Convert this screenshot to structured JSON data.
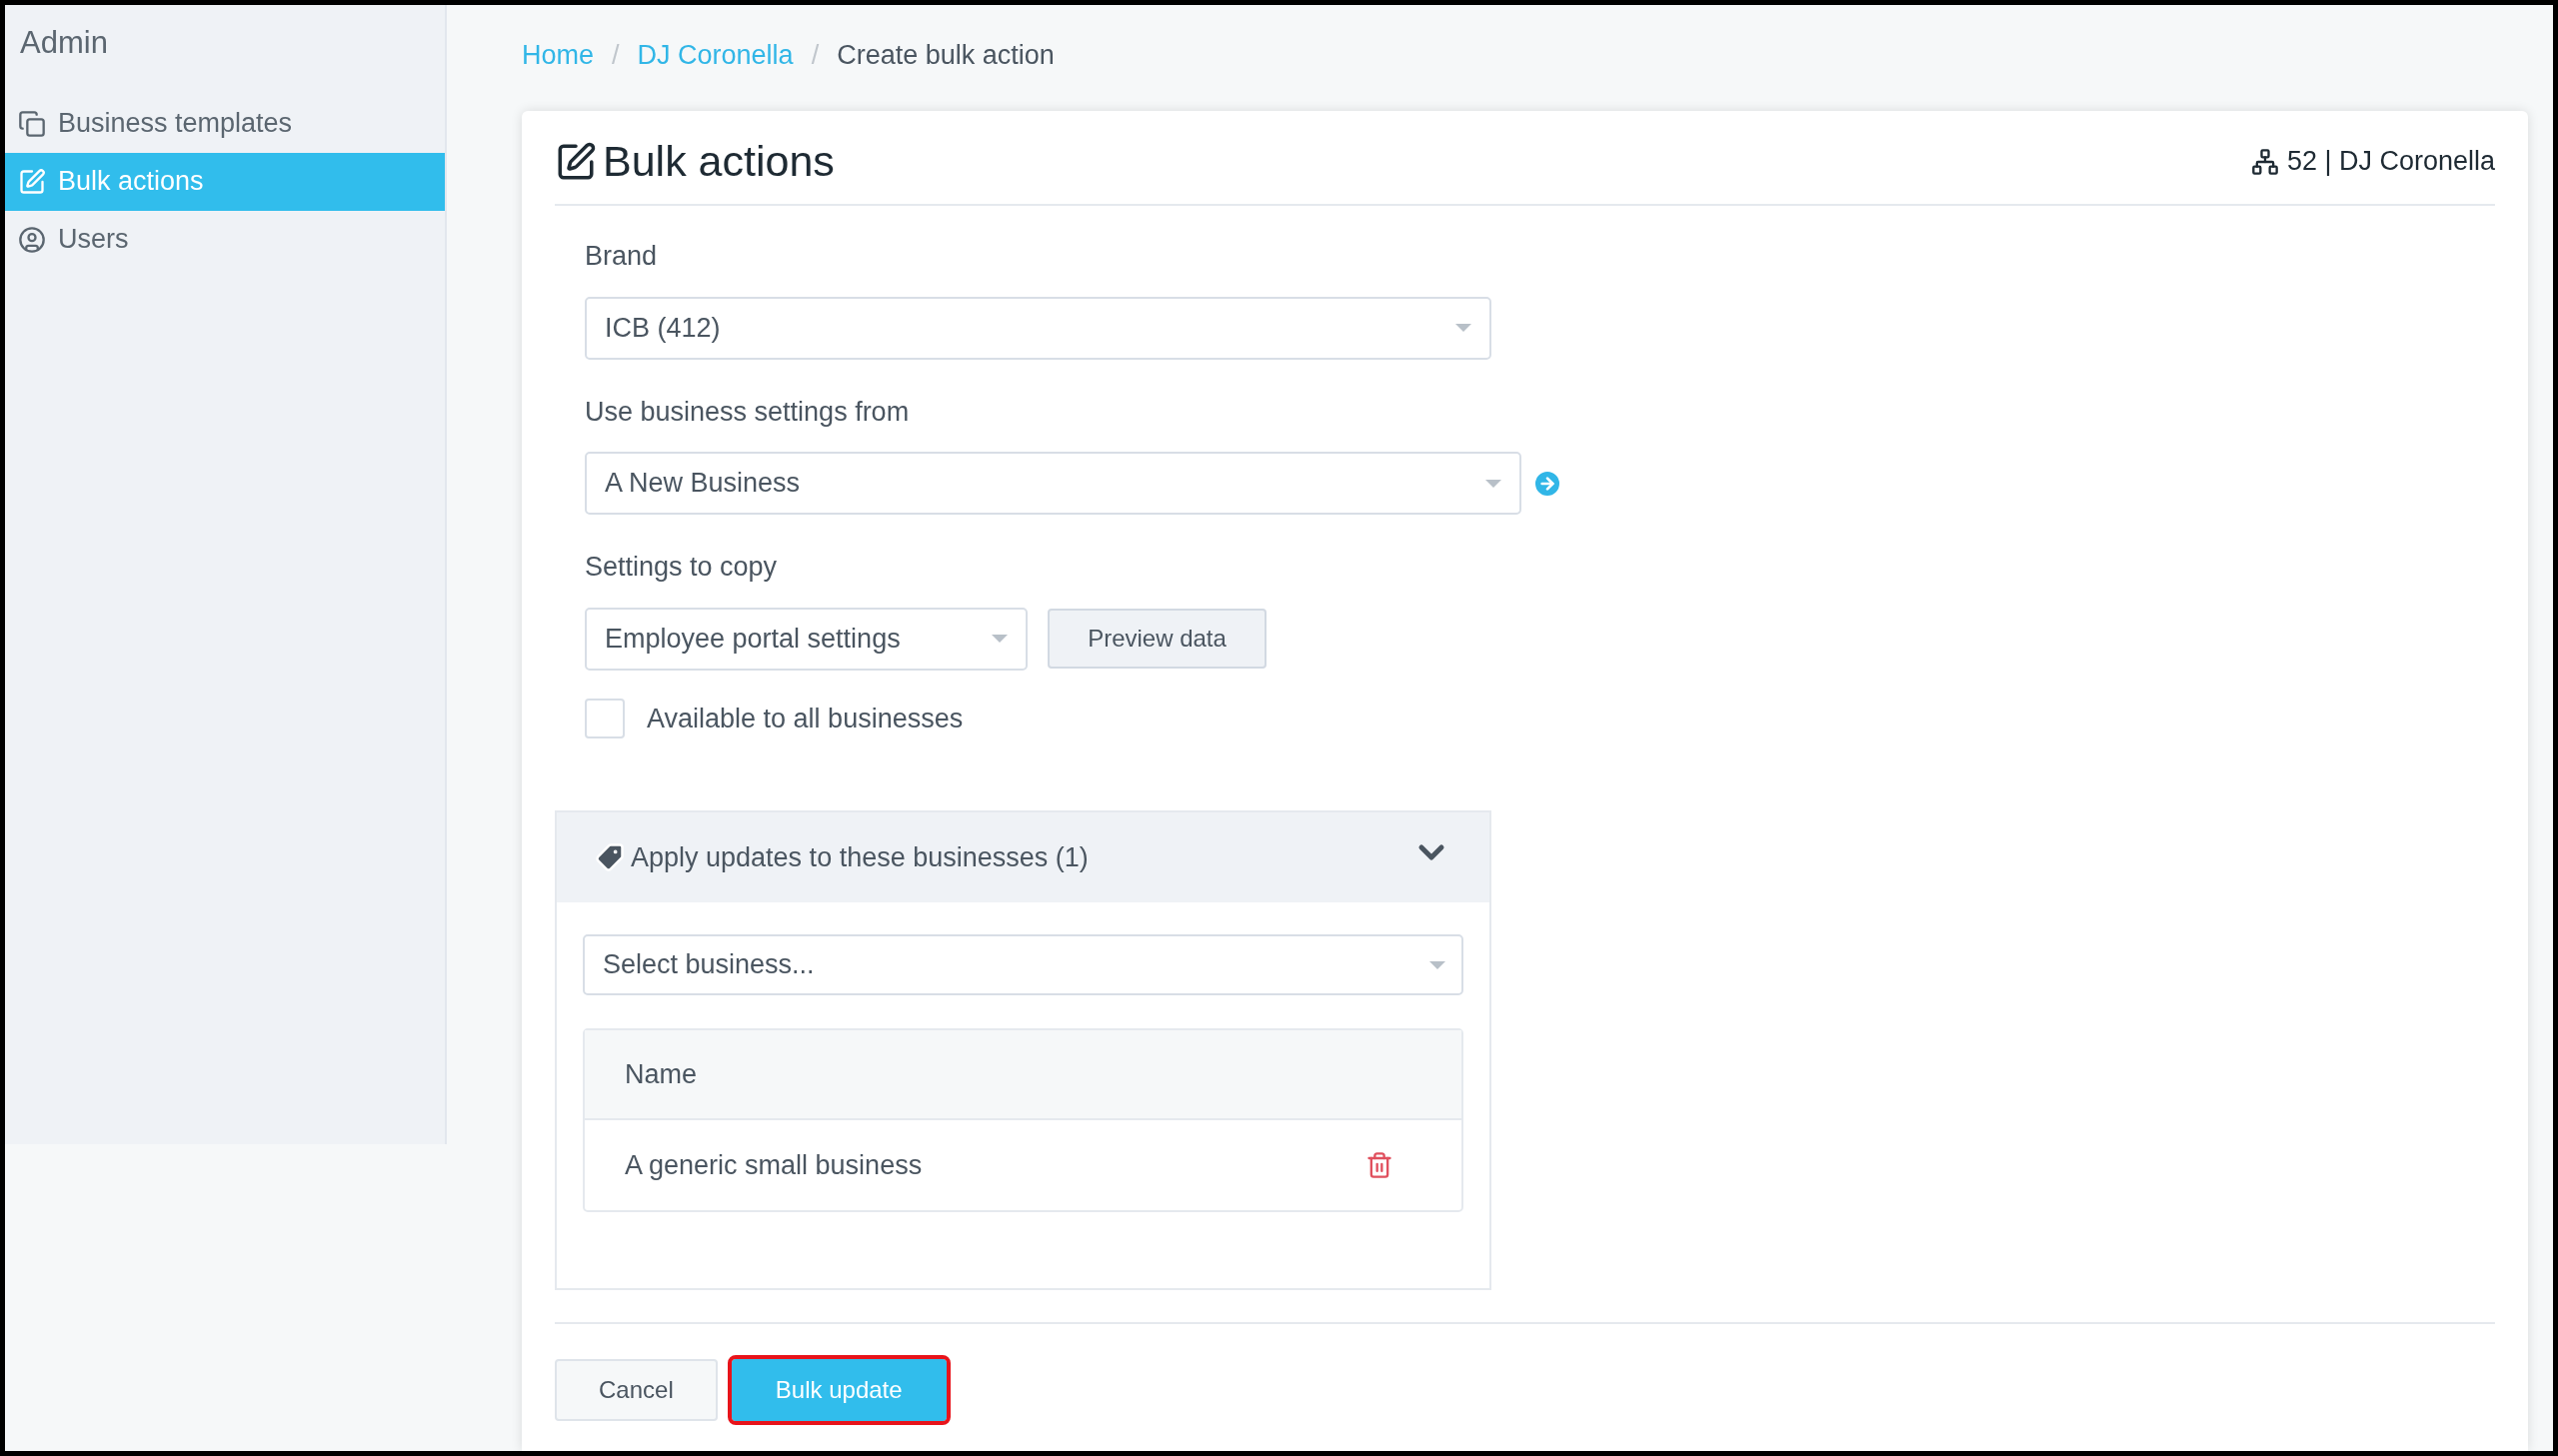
{
  "sidebar": {
    "title": "Admin",
    "items": [
      {
        "label": "Business templates",
        "kind": "templates",
        "selected": false
      },
      {
        "label": "Bulk actions",
        "kind": "bulk",
        "selected": true
      },
      {
        "label": "Users",
        "kind": "users",
        "selected": false
      }
    ]
  },
  "breadcrumb_separator": "/",
  "breadcrumb": [
    {
      "label": "Home",
      "kind": "link"
    },
    {
      "label": "DJ Coronella",
      "kind": "link"
    },
    {
      "label": "Create bulk action",
      "kind": "current"
    }
  ],
  "page": {
    "title": "Bulk actions",
    "account": "52 | DJ Coronella"
  },
  "form": {
    "brand_label": "Brand",
    "brand_value": "ICB (412)",
    "settings_from_label": "Use business settings from",
    "settings_from_value": "A New Business",
    "settings_copy_label": "Settings to copy",
    "settings_copy_value": "Employee portal settings",
    "preview_button": "Preview data",
    "all_businesses": {
      "label": "Available to all businesses",
      "checked": false
    }
  },
  "businesses": {
    "title": "Apply updates to these businesses (1)",
    "expanded": true,
    "placeholder": "Select business...",
    "columns": [
      "Name"
    ],
    "rows": [
      {
        "name": "A generic small business"
      }
    ]
  },
  "buttons": [
    {
      "label": "Cancel",
      "kind": "secondary",
      "highlighted": false
    },
    {
      "label": "Bulk update",
      "kind": "primary",
      "highlighted": true
    }
  ]
}
